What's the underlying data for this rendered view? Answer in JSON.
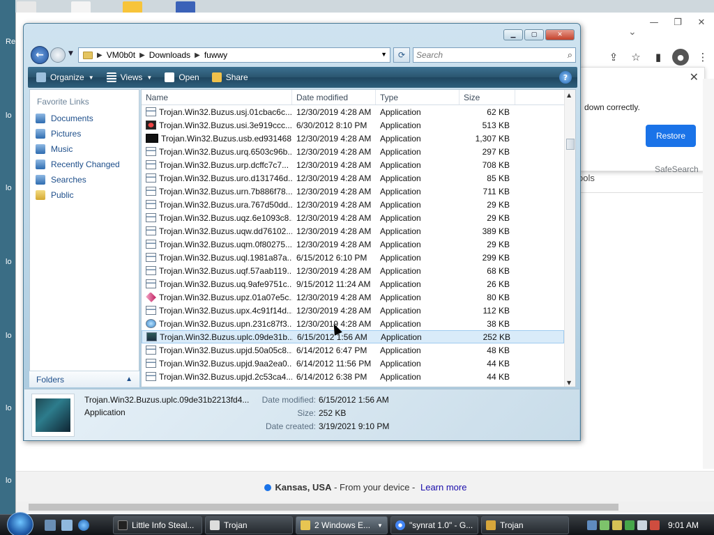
{
  "desktop": {
    "labels": [
      "Re",
      "lo",
      "lo",
      "lo",
      "lo",
      "lo",
      "lo",
      "lo"
    ]
  },
  "chrome": {
    "bubble_text": "down correctly.",
    "restore_label": "Restore",
    "safesearch": "SafeSearch",
    "tools_fragment": "ools",
    "footer": {
      "location": "Kansas, USA",
      "from_device": " - From your device - ",
      "learn_more": "Learn more"
    }
  },
  "explorer": {
    "address": {
      "crumbs": [
        "VM0b0t",
        "Downloads",
        "fuwwy"
      ]
    },
    "search_placeholder": "Search",
    "commands": [
      {
        "label": "Organize",
        "icon": "organize-icon",
        "has_menu": true
      },
      {
        "label": "Views",
        "icon": "views-icon",
        "has_menu": true
      },
      {
        "label": "Open",
        "icon": "open-icon",
        "has_menu": false
      },
      {
        "label": "Share",
        "icon": "share-icon",
        "has_menu": false
      }
    ],
    "nav_pane": {
      "title": "Favorite Links",
      "items": [
        "Documents",
        "Pictures",
        "Music",
        "Recently Changed",
        "Searches",
        "Public"
      ],
      "folders_label": "Folders"
    },
    "columns": [
      "Name",
      "Date modified",
      "Type",
      "Size"
    ],
    "files": [
      {
        "name": "Trojan.Win32.Buzus.usj.01cbac6c...",
        "date": "12/30/2019 4:28 AM",
        "type": "Application",
        "size": "62 KB",
        "icon": "app"
      },
      {
        "name": "Trojan.Win32.Buzus.usi.3e919ccc...",
        "date": "6/30/2012 8:10 PM",
        "type": "Application",
        "size": "513 KB",
        "icon": "red"
      },
      {
        "name": "Trojan.Win32.Buzus.usb.ed931468...",
        "date": "12/30/2019 4:28 AM",
        "type": "Application",
        "size": "1,307 KB",
        "icon": "cmd"
      },
      {
        "name": "Trojan.Win32.Buzus.urq.6503c96b...",
        "date": "12/30/2019 4:28 AM",
        "type": "Application",
        "size": "297 KB",
        "icon": "app"
      },
      {
        "name": "Trojan.Win32.Buzus.urp.dcffc7c7...",
        "date": "12/30/2019 4:28 AM",
        "type": "Application",
        "size": "708 KB",
        "icon": "app"
      },
      {
        "name": "Trojan.Win32.Buzus.uro.d131746d...",
        "date": "12/30/2019 4:28 AM",
        "type": "Application",
        "size": "85 KB",
        "icon": "app"
      },
      {
        "name": "Trojan.Win32.Buzus.urn.7b886f78...",
        "date": "12/30/2019 4:28 AM",
        "type": "Application",
        "size": "711 KB",
        "icon": "app"
      },
      {
        "name": "Trojan.Win32.Buzus.ura.767d50dd...",
        "date": "12/30/2019 4:28 AM",
        "type": "Application",
        "size": "29 KB",
        "icon": "app"
      },
      {
        "name": "Trojan.Win32.Buzus.uqz.6e1093c8...",
        "date": "12/30/2019 4:28 AM",
        "type": "Application",
        "size": "29 KB",
        "icon": "app"
      },
      {
        "name": "Trojan.Win32.Buzus.uqw.dd76102...",
        "date": "12/30/2019 4:28 AM",
        "type": "Application",
        "size": "389 KB",
        "icon": "app"
      },
      {
        "name": "Trojan.Win32.Buzus.uqm.0f80275...",
        "date": "12/30/2019 4:28 AM",
        "type": "Application",
        "size": "29 KB",
        "icon": "app"
      },
      {
        "name": "Trojan.Win32.Buzus.uql.1981a87a...",
        "date": "6/15/2012 6:10 PM",
        "type": "Application",
        "size": "299 KB",
        "icon": "app"
      },
      {
        "name": "Trojan.Win32.Buzus.uqf.57aab119...",
        "date": "12/30/2019 4:28 AM",
        "type": "Application",
        "size": "68 KB",
        "icon": "app"
      },
      {
        "name": "Trojan.Win32.Buzus.uq.9afe9751c...",
        "date": "9/15/2012 11:24 AM",
        "type": "Application",
        "size": "26 KB",
        "icon": "window"
      },
      {
        "name": "Trojan.Win32.Buzus.upz.01a07e5c...",
        "date": "12/30/2019 4:28 AM",
        "type": "Application",
        "size": "80 KB",
        "icon": "diamond"
      },
      {
        "name": "Trojan.Win32.Buzus.upx.4c91f14d...",
        "date": "12/30/2019 4:28 AM",
        "type": "Application",
        "size": "112 KB",
        "icon": "app"
      },
      {
        "name": "Trojan.Win32.Buzus.upn.231c87f3...",
        "date": "12/30/2019 4:28 AM",
        "type": "Application",
        "size": "38 KB",
        "icon": "globe"
      },
      {
        "name": "Trojan.Win32.Buzus.uplc.09de31b...",
        "date": "6/15/2012 1:56 AM",
        "type": "Application",
        "size": "252 KB",
        "icon": "photo",
        "selected": true
      },
      {
        "name": "Trojan.Win32.Buzus.upjd.50a05c8...",
        "date": "6/14/2012 6:47 PM",
        "type": "Application",
        "size": "48 KB",
        "icon": "app"
      },
      {
        "name": "Trojan.Win32.Buzus.upjd.9aa2ea0...",
        "date": "6/14/2012 11:56 PM",
        "type": "Application",
        "size": "44 KB",
        "icon": "app"
      },
      {
        "name": "Trojan.Win32.Buzus.upjd.2c53ca4...",
        "date": "6/14/2012 6:38 PM",
        "type": "Application",
        "size": "44 KB",
        "icon": "app"
      }
    ],
    "details": {
      "name": "Trojan.Win32.Buzus.uplc.09de31b2213fd4...",
      "type": "Application",
      "date_modified_label": "Date modified:",
      "date_modified": "6/15/2012 1:56 AM",
      "size_label": "Size:",
      "size": "252 KB",
      "date_created_label": "Date created:",
      "date_created": "3/19/2021 9:10 PM"
    }
  },
  "taskbar": {
    "tasks": [
      {
        "label": "Little Info Steal...",
        "active": false
      },
      {
        "label": "Trojan",
        "active": false
      },
      {
        "label": "2 Windows E...",
        "active": true
      },
      {
        "label": "\"synrat 1.0\" - G...",
        "active": false
      },
      {
        "label": "Trojan",
        "active": false
      }
    ],
    "clock": "9:01 AM"
  },
  "colors": {
    "accent_blue": "#1a73e8",
    "selection": "#d9ebf9",
    "cmdbar": "#2a556f"
  }
}
